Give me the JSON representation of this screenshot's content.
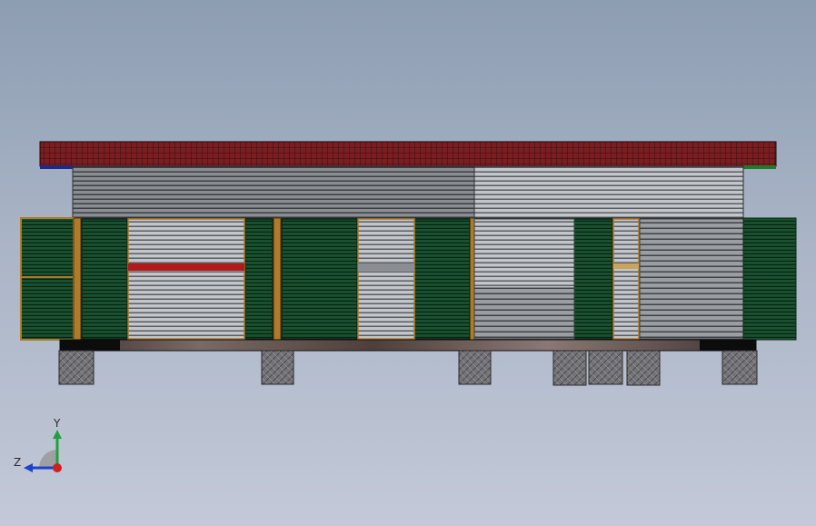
{
  "viewport": {
    "background_top": "#8d9db2",
    "background_bottom": "#c3c9d8"
  },
  "model": {
    "name": "",
    "colors": {
      "roof": "#7a1e22",
      "roof_grid": "#3a0e10",
      "siding_dark": "#4f5357",
      "siding_light": "#b9bcc0",
      "wall_grey": "#8a8d91",
      "panel_green": "#14452a",
      "post_wood": "#b07a28",
      "red_band": "#b21a1a",
      "sill": "#5a4a46",
      "footing": "#6e6e72",
      "trim_blue": "#1e2a88",
      "trim_green": "#1f7a2a"
    },
    "footing_count": 7
  },
  "triad": {
    "x_label": "",
    "y_label": "Y",
    "z_label": "Z",
    "y_color": "#1fa23c",
    "z_color": "#2340c8",
    "x_color": "#d02020"
  }
}
